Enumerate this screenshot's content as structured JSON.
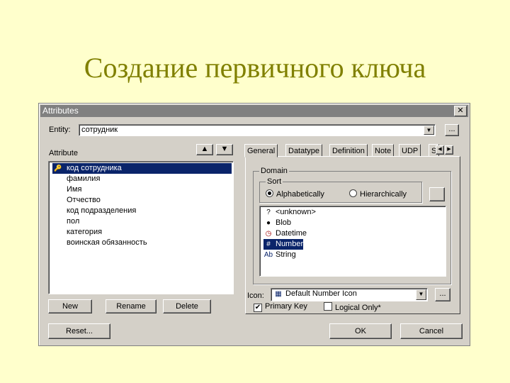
{
  "slide_title": "Создание первичного ключа",
  "dialog": {
    "title": "Attributes",
    "close_glyph": "✕",
    "entity_label": "Entity:",
    "entity_value": "сотрудник",
    "entity_more": "...",
    "attribute_label": "Attribute",
    "attributes": [
      "код сотрудника",
      "фамилия",
      "Имя",
      "Отчество",
      "код подразделения",
      "пол",
      "категория",
      "воинская обязанность"
    ],
    "selected_attribute_index": 0,
    "buttons": {
      "new": "New",
      "rename": "Rename",
      "delete": "Delete",
      "reset": "Reset...",
      "ok": "OK",
      "cancel": "Cancel"
    },
    "tabs": [
      "General",
      "Datatype",
      "Definition",
      "Note",
      "UDP",
      "S"
    ],
    "active_tab_index": 0,
    "domain": {
      "group_label": "Domain",
      "sort_label": "Sort",
      "sort_options": [
        "Alphabetically",
        "Hierarchically"
      ],
      "sort_selected_index": 0,
      "items": [
        {
          "icon": "?",
          "label": "<unknown>"
        },
        {
          "icon": "●",
          "label": "Blob"
        },
        {
          "icon": "◷",
          "label": "Datetime"
        },
        {
          "icon": "#",
          "label": "Number"
        },
        {
          "icon": "Ab",
          "label": "String"
        }
      ],
      "selected_item_index": 3
    },
    "icon_label": "Icon:",
    "icon_value": "Default Number Icon",
    "icon_more": "...",
    "primary_key_label": "Primary Key",
    "primary_key_checked": true,
    "logical_only_label": "Logical Only*",
    "logical_only_checked": false
  }
}
